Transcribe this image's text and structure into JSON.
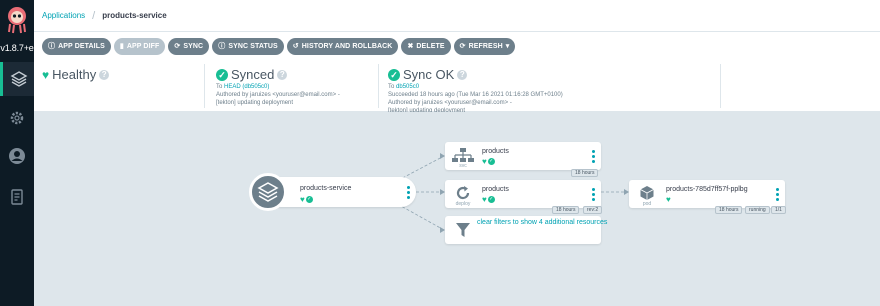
{
  "sidebar": {
    "version": "v1.8.7+e",
    "nav": [
      "layers-icon",
      "gear-icon",
      "user-icon",
      "docs-icon"
    ]
  },
  "breadcrumb": {
    "root": "Applications",
    "current": "products-service"
  },
  "toolbar": {
    "app_details": "APP DETAILS",
    "app_diff": "APP DIFF",
    "sync": "SYNC",
    "sync_status": "SYNC STATUS",
    "history": "HISTORY AND ROLLBACK",
    "delete": "DELETE",
    "refresh": "REFRESH"
  },
  "status": {
    "health": "Healthy",
    "sync": {
      "title": "Synced",
      "to_prefix": "To",
      "to_rev": "HEAD (db505c0)",
      "author": "Authored by jaruizes <youruser@email.com> -",
      "message": "[tekton] updating deployment"
    },
    "operation": {
      "title": "Sync OK",
      "to_prefix": "To",
      "to_rev": "db505c0",
      "succeeded": "Succeeded 18 hours ago (Tue Mar 16 2021 01:16:28 GMT+0100)",
      "author": "Authored by jaruizes <youruser@email.com> -",
      "message": "[tekton] updating deployment"
    }
  },
  "tree": {
    "app": {
      "name": "products-service"
    },
    "svc": {
      "name": "products",
      "kind": "svc",
      "age": "18 hours"
    },
    "deploy": {
      "name": "products",
      "kind": "deploy",
      "age": "18 hours",
      "rev": "rev:2"
    },
    "pod": {
      "name": "products-785d7ff57f-pplbg",
      "kind": "pod",
      "age": "18 hours",
      "state": "running",
      "count": "1/1"
    },
    "filter": {
      "text": "clear filters to show 4 additional resources"
    }
  },
  "colors": {
    "accent": "#18be94",
    "link": "#00a2b3",
    "sidebar": "#0d1b25"
  }
}
